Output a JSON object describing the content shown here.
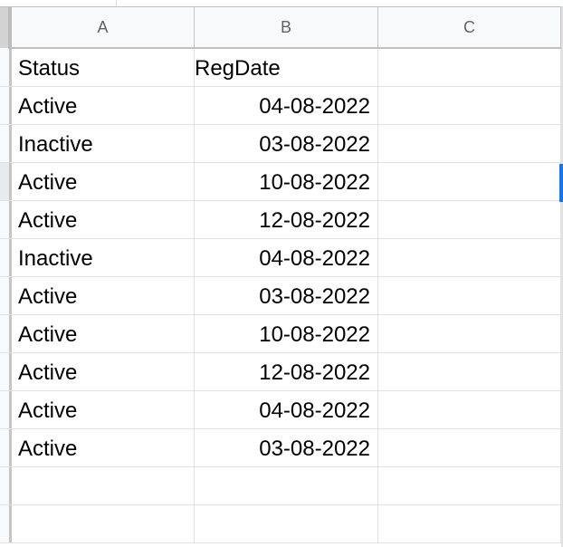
{
  "sheet": {
    "columns": [
      "A",
      "B",
      "C"
    ],
    "header_row": {
      "A": "Status",
      "B": "RegDate",
      "C": ""
    },
    "rows": [
      {
        "status": "Active",
        "regdate": "04-08-2022"
      },
      {
        "status": "Inactive",
        "regdate": "03-08-2022"
      },
      {
        "status": "Active",
        "regdate": "10-08-2022"
      },
      {
        "status": "Active",
        "regdate": "12-08-2022"
      },
      {
        "status": "Inactive",
        "regdate": "04-08-2022"
      },
      {
        "status": "Active",
        "regdate": "03-08-2022"
      },
      {
        "status": "Active",
        "regdate": "10-08-2022"
      },
      {
        "status": "Active",
        "regdate": "12-08-2022"
      },
      {
        "status": "Active",
        "regdate": "04-08-2022"
      },
      {
        "status": "Active",
        "regdate": "03-08-2022"
      }
    ],
    "selected_row_index": 3,
    "selection_color": "#1a73e8"
  }
}
